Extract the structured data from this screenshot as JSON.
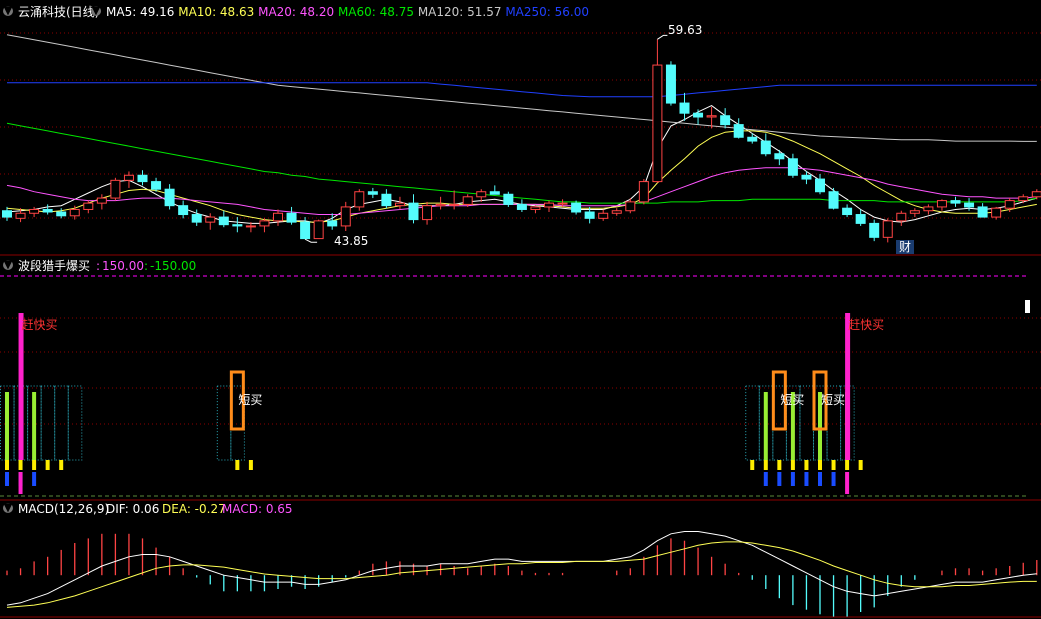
{
  "colors": {
    "bg": "#000000",
    "up": "#ff4444",
    "down": "#54fcfc",
    "grid": "#8b0000",
    "ma5": "#ffffff",
    "ma10": "#ffff55",
    "ma20": "#ff55ff",
    "ma60": "#00e600",
    "ma120": "#c8c8c8",
    "ma250": "#2040ff",
    "dif": "#ffffff",
    "dea": "#ffff55",
    "macd_label": "#ff55ff",
    "level_line": "#ff00ff",
    "zero_line": "#5a8a3a"
  },
  "main_panel": {
    "stock": "云涌科技(日线)",
    "indicators": [
      {
        "label": "MA5: 49.16",
        "color": "#ffffff"
      },
      {
        "label": "MA10: 48.63",
        "color": "#ffff55"
      },
      {
        "label": "MA20: 48.20",
        "color": "#ff55ff"
      },
      {
        "label": "MA60: 48.75",
        "color": "#00e600"
      },
      {
        "label": "MA120: 51.57",
        "color": "#c8c8c8"
      },
      {
        "label": "MA250: 56.00",
        "color": "#2040ff"
      }
    ],
    "high_label": "59.63",
    "low_label": "43.85",
    "fin_badge": "财"
  },
  "signal_panel": {
    "title": "波段猎手爆买",
    "val1": "150.00",
    "val2": "-150.00",
    "labels": [
      "赶快买",
      "短买",
      "短买",
      "短买",
      "赶快买"
    ]
  },
  "macd_panel": {
    "title": "MACD(12,26,9)",
    "dif": "DIF: 0.06",
    "dea": "DEA: -0.27",
    "macd": "MACD: 0.65"
  },
  "chart_data": {
    "type": "candlestick",
    "ylim": [
      43,
      61
    ],
    "candles": [
      [
        46.1,
        46.4,
        45.3,
        45.6
      ],
      [
        45.5,
        46.3,
        45.2,
        45.9
      ],
      [
        45.9,
        46.4,
        45.6,
        46.2
      ],
      [
        46.2,
        46.6,
        45.8,
        46.0
      ],
      [
        46.0,
        46.3,
        45.5,
        45.7
      ],
      [
        45.7,
        46.5,
        45.4,
        46.2
      ],
      [
        46.2,
        46.9,
        45.9,
        46.7
      ],
      [
        46.7,
        47.4,
        46.2,
        47.1
      ],
      [
        47.1,
        48.7,
        46.9,
        48.5
      ],
      [
        48.5,
        49.2,
        47.9,
        48.9
      ],
      [
        48.9,
        49.3,
        48.1,
        48.4
      ],
      [
        48.4,
        48.7,
        47.6,
        47.8
      ],
      [
        47.8,
        48.2,
        46.2,
        46.5
      ],
      [
        46.5,
        46.9,
        45.5,
        45.8
      ],
      [
        45.8,
        46.2,
        44.9,
        45.2
      ],
      [
        45.2,
        45.9,
        44.6,
        45.6
      ],
      [
        45.6,
        46.1,
        44.8,
        45.0
      ],
      [
        45.0,
        45.6,
        44.4,
        44.9
      ],
      [
        44.9,
        45.2,
        44.4,
        44.9
      ],
      [
        44.9,
        45.5,
        44.4,
        45.3
      ],
      [
        45.3,
        46.2,
        44.9,
        45.9
      ],
      [
        45.9,
        46.4,
        45.0,
        45.2
      ],
      [
        45.2,
        45.6,
        43.85,
        43.9
      ],
      [
        43.9,
        45.4,
        43.9,
        45.3
      ],
      [
        45.3,
        45.9,
        44.6,
        44.9
      ],
      [
        44.9,
        46.8,
        44.5,
        46.4
      ],
      [
        46.4,
        47.8,
        46.1,
        47.6
      ],
      [
        47.6,
        47.9,
        47.1,
        47.4
      ],
      [
        47.4,
        47.8,
        46.3,
        46.5
      ],
      [
        46.5,
        47.2,
        46.2,
        46.7
      ],
      [
        46.7,
        47.4,
        45.1,
        45.4
      ],
      [
        45.4,
        46.8,
        45.0,
        46.5
      ],
      [
        46.5,
        47.2,
        46.2,
        46.6
      ],
      [
        46.6,
        47.7,
        46.2,
        46.6
      ],
      [
        46.6,
        47.4,
        46.4,
        47.2
      ],
      [
        47.2,
        47.8,
        46.8,
        47.6
      ],
      [
        47.6,
        48.1,
        47.4,
        47.4
      ],
      [
        47.4,
        47.6,
        46.4,
        46.6
      ],
      [
        46.6,
        47.0,
        46.0,
        46.2
      ],
      [
        46.2,
        46.5,
        45.9,
        46.4
      ],
      [
        46.4,
        46.9,
        46.0,
        46.7
      ],
      [
        46.7,
        47.0,
        46.4,
        46.7
      ],
      [
        46.7,
        46.9,
        45.8,
        46.0
      ],
      [
        46.0,
        46.4,
        45.1,
        45.5
      ],
      [
        45.5,
        46.2,
        45.3,
        45.9
      ],
      [
        45.9,
        46.3,
        45.7,
        46.1
      ],
      [
        46.1,
        47.1,
        45.9,
        46.8
      ],
      [
        46.8,
        48.6,
        46.6,
        48.4
      ],
      [
        48.4,
        59.63,
        48.3,
        57.6
      ],
      [
        57.6,
        57.9,
        54.4,
        54.6
      ],
      [
        54.6,
        55.4,
        53.2,
        53.8
      ],
      [
        53.8,
        54.1,
        52.9,
        53.5
      ],
      [
        53.5,
        54.3,
        52.6,
        53.6
      ],
      [
        53.6,
        54.2,
        52.6,
        52.9
      ],
      [
        52.9,
        53.4,
        51.8,
        51.9
      ],
      [
        51.9,
        52.2,
        51.4,
        51.6
      ],
      [
        51.6,
        52.2,
        50.4,
        50.6
      ],
      [
        50.6,
        50.9,
        49.7,
        50.2
      ],
      [
        50.2,
        50.6,
        48.7,
        48.9
      ],
      [
        48.9,
        49.2,
        48.2,
        48.6
      ],
      [
        48.6,
        49.0,
        47.4,
        47.6
      ],
      [
        47.6,
        47.9,
        46.2,
        46.3
      ],
      [
        46.3,
        46.6,
        45.6,
        45.8
      ],
      [
        45.8,
        46.2,
        44.9,
        45.1
      ],
      [
        45.1,
        45.4,
        43.7,
        44.0
      ],
      [
        44.0,
        45.5,
        43.6,
        45.3
      ],
      [
        45.3,
        46.1,
        44.9,
        45.9
      ],
      [
        45.9,
        46.3,
        45.6,
        46.1
      ],
      [
        46.1,
        46.6,
        45.8,
        46.4
      ],
      [
        46.4,
        47.0,
        46.1,
        46.9
      ],
      [
        46.9,
        47.2,
        46.4,
        46.7
      ],
      [
        46.7,
        47.1,
        46.1,
        46.4
      ],
      [
        46.4,
        46.7,
        45.9,
        45.6
      ],
      [
        45.6,
        46.4,
        45.4,
        46.3
      ],
      [
        46.3,
        47.1,
        46.0,
        46.9
      ],
      [
        46.9,
        47.4,
        46.7,
        47.2
      ],
      [
        47.2,
        47.8,
        47.0,
        47.6
      ]
    ],
    "ma_series": [
      {
        "name": "MA5",
        "color": "#ffffff",
        "values": [
          46.0,
          46.1,
          46.2,
          46.4,
          46.5,
          47.0,
          47.5,
          48.0,
          48.4,
          48.5,
          48.0,
          47.4,
          46.8,
          46.3,
          45.9,
          45.6,
          45.3,
          45.2,
          45.1,
          45.1,
          45.2,
          45.3,
          45.3,
          45.1,
          45.5,
          46.2,
          46.6,
          46.8,
          47.0,
          46.8,
          46.5,
          46.5,
          46.5,
          46.6,
          46.8,
          46.9,
          47.0,
          46.8,
          46.6,
          46.5,
          46.4,
          46.3,
          46.2,
          46.2,
          46.2,
          46.5,
          47.0,
          48.0,
          51.0,
          52.8,
          53.3,
          53.9,
          54.4,
          53.6,
          52.9,
          52.2,
          51.5,
          50.8,
          50.0,
          49.2,
          48.5,
          47.7,
          47.0,
          46.2,
          45.6,
          45.3,
          45.2,
          45.4,
          45.7,
          46.0,
          46.2,
          46.3,
          46.2,
          46.3,
          46.5,
          46.8,
          47.1
        ]
      },
      {
        "name": "MA10",
        "color": "#ffff55",
        "values": [
          46.3,
          46.2,
          46.1,
          46.0,
          46.1,
          46.3,
          46.7,
          47.1,
          47.4,
          47.7,
          47.8,
          47.7,
          47.4,
          47.1,
          46.8,
          46.5,
          46.1,
          45.8,
          45.6,
          45.4,
          45.3,
          45.3,
          45.2,
          45.2,
          45.3,
          45.6,
          45.9,
          46.1,
          46.3,
          46.5,
          46.6,
          46.7,
          46.7,
          46.6,
          46.6,
          46.6,
          46.6,
          46.6,
          46.6,
          46.6,
          46.5,
          46.4,
          46.3,
          46.3,
          46.3,
          46.4,
          46.6,
          47.1,
          48.3,
          49.3,
          50.2,
          51.2,
          51.9,
          52.3,
          52.4,
          52.4,
          52.3,
          52.0,
          51.6,
          51.1,
          50.6,
          50.0,
          49.4,
          48.8,
          48.1,
          47.5,
          46.9,
          46.5,
          46.2,
          46.0,
          45.9,
          45.9,
          45.9,
          46.0,
          46.2,
          46.4,
          46.6
        ]
      },
      {
        "name": "MA20",
        "color": "#ff55ff",
        "values": [
          48.1,
          47.9,
          47.6,
          47.4,
          47.2,
          47.0,
          46.9,
          46.9,
          46.9,
          47.0,
          47.1,
          47.1,
          47.1,
          47.0,
          46.9,
          46.8,
          46.7,
          46.6,
          46.4,
          46.2,
          46.1,
          46.0,
          45.9,
          45.8,
          45.8,
          45.8,
          45.9,
          46.0,
          46.1,
          46.2,
          46.3,
          46.4,
          46.5,
          46.5,
          46.5,
          46.6,
          46.6,
          46.6,
          46.6,
          46.6,
          46.6,
          46.5,
          46.5,
          46.5,
          46.5,
          46.5,
          46.6,
          46.8,
          47.2,
          47.6,
          48.0,
          48.4,
          48.8,
          49.1,
          49.3,
          49.4,
          49.5,
          49.5,
          49.5,
          49.4,
          49.3,
          49.1,
          48.9,
          48.7,
          48.5,
          48.2,
          48.0,
          47.8,
          47.6,
          47.4,
          47.3,
          47.2,
          47.2,
          47.1,
          47.1,
          47.1,
          47.2
        ]
      },
      {
        "name": "MA60",
        "color": "#00e600",
        "values": [
          53.0,
          52.8,
          52.6,
          52.4,
          52.2,
          52.0,
          51.8,
          51.6,
          51.4,
          51.2,
          51.0,
          50.8,
          50.6,
          50.4,
          50.2,
          50.0,
          49.8,
          49.6,
          49.4,
          49.2,
          49.1,
          48.9,
          48.8,
          48.6,
          48.5,
          48.4,
          48.3,
          48.2,
          48.1,
          48.0,
          47.9,
          47.8,
          47.7,
          47.6,
          47.5,
          47.4,
          47.3,
          47.2,
          47.1,
          47.0,
          46.9,
          46.8,
          46.8,
          46.7,
          46.7,
          46.7,
          46.7,
          46.7,
          46.7,
          46.8,
          46.8,
          46.8,
          46.9,
          46.9,
          46.9,
          47.0,
          47.0,
          47.0,
          47.0,
          47.0,
          47.0,
          46.9,
          46.9,
          46.9,
          46.9,
          46.8,
          46.8,
          46.8,
          46.8,
          46.8,
          46.8,
          46.8,
          46.8,
          46.8,
          46.8,
          46.9,
          47.1
        ]
      },
      {
        "name": "MA120",
        "color": "#c8c8c8",
        "values": [
          60.0,
          59.8,
          59.6,
          59.4,
          59.2,
          59.0,
          58.8,
          58.6,
          58.4,
          58.2,
          58.0,
          57.8,
          57.6,
          57.4,
          57.2,
          57.0,
          56.8,
          56.6,
          56.4,
          56.2,
          56.0,
          55.9,
          55.8,
          55.7,
          55.6,
          55.5,
          55.4,
          55.3,
          55.2,
          55.1,
          55.0,
          54.9,
          54.8,
          54.7,
          54.6,
          54.5,
          54.4,
          54.3,
          54.2,
          54.1,
          54.0,
          53.9,
          53.8,
          53.7,
          53.6,
          53.5,
          53.4,
          53.3,
          53.2,
          53.1,
          53.0,
          52.9,
          52.8,
          52.7,
          52.6,
          52.5,
          52.4,
          52.3,
          52.2,
          52.1,
          52.0,
          51.95,
          51.9,
          51.85,
          51.8,
          51.75,
          51.7,
          51.7,
          51.7,
          51.65,
          51.6,
          51.6,
          51.6,
          51.6,
          51.6,
          51.57,
          51.57
        ]
      },
      {
        "name": "MA250",
        "color": "#2040ff",
        "values": [
          56.2,
          56.2,
          56.2,
          56.2,
          56.2,
          56.2,
          56.2,
          56.2,
          56.2,
          56.2,
          56.2,
          56.2,
          56.2,
          56.2,
          56.2,
          56.2,
          56.2,
          56.2,
          56.2,
          56.2,
          56.2,
          56.2,
          56.2,
          56.2,
          56.2,
          56.2,
          56.2,
          56.2,
          56.2,
          56.2,
          56.2,
          56.2,
          56.1,
          56.0,
          55.9,
          55.8,
          55.7,
          55.6,
          55.5,
          55.4,
          55.3,
          55.2,
          55.15,
          55.1,
          55.1,
          55.1,
          55.1,
          55.1,
          55.1,
          55.2,
          55.3,
          55.4,
          55.5,
          55.6,
          55.7,
          55.8,
          55.9,
          56.0,
          56.0,
          56.0,
          56.0,
          56.0,
          56.0,
          56.0,
          56.0,
          56.0,
          56.0,
          56.0,
          56.0,
          56.0,
          56.0,
          56.0,
          56.0,
          56.0,
          56.0,
          56.0,
          56.0
        ]
      }
    ],
    "signals": {
      "green": [
        0,
        2,
        56,
        58,
        60,
        62
      ],
      "magenta": [
        1,
        62
      ],
      "orange_box": [
        17,
        57,
        60
      ],
      "dotted_boxes": [
        [
          0,
          5
        ],
        [
          16,
          17
        ],
        [
          55,
          62
        ]
      ],
      "yellow_ticks": [
        0,
        1,
        2,
        3,
        4,
        17,
        18,
        55,
        56,
        57,
        58,
        59,
        60,
        61,
        62,
        63
      ],
      "blue_ticks": [
        0,
        1,
        2,
        56,
        57,
        58,
        59,
        60,
        61
      ],
      "buy_label_idx": [
        1,
        17,
        57,
        60,
        62
      ]
    },
    "macd": {
      "ylim": [
        -1.6,
        2.4
      ],
      "dif": [
        -1.3,
        -1.2,
        -1.0,
        -0.8,
        -0.5,
        -0.2,
        0.1,
        0.4,
        0.6,
        0.8,
        0.9,
        0.9,
        0.8,
        0.6,
        0.4,
        0.2,
        0.0,
        -0.1,
        -0.2,
        -0.3,
        -0.3,
        -0.3,
        -0.4,
        -0.4,
        -0.3,
        -0.2,
        0.0,
        0.2,
        0.3,
        0.4,
        0.4,
        0.4,
        0.5,
        0.5,
        0.5,
        0.6,
        0.7,
        0.7,
        0.6,
        0.6,
        0.6,
        0.6,
        0.6,
        0.6,
        0.6,
        0.7,
        0.8,
        1.1,
        1.5,
        1.8,
        1.9,
        1.9,
        1.8,
        1.7,
        1.5,
        1.3,
        1.0,
        0.7,
        0.4,
        0.1,
        -0.2,
        -0.5,
        -0.7,
        -0.8,
        -0.9,
        -0.8,
        -0.7,
        -0.6,
        -0.5,
        -0.4,
        -0.3,
        -0.3,
        -0.3,
        -0.2,
        -0.1,
        0.0,
        0.06
      ],
      "dea": [
        -1.4,
        -1.35,
        -1.3,
        -1.2,
        -1.05,
        -0.9,
        -0.7,
        -0.5,
        -0.3,
        -0.1,
        0.1,
        0.3,
        0.4,
        0.45,
        0.45,
        0.4,
        0.35,
        0.25,
        0.15,
        0.05,
        0.0,
        -0.05,
        -0.1,
        -0.15,
        -0.15,
        -0.15,
        -0.1,
        -0.05,
        0.0,
        0.1,
        0.15,
        0.2,
        0.25,
        0.3,
        0.35,
        0.4,
        0.45,
        0.5,
        0.5,
        0.55,
        0.55,
        0.55,
        0.6,
        0.6,
        0.6,
        0.6,
        0.65,
        0.7,
        0.85,
        1.0,
        1.15,
        1.3,
        1.4,
        1.45,
        1.45,
        1.4,
        1.3,
        1.2,
        1.05,
        0.85,
        0.65,
        0.4,
        0.2,
        0.0,
        -0.2,
        -0.35,
        -0.45,
        -0.5,
        -0.5,
        -0.5,
        -0.45,
        -0.45,
        -0.4,
        -0.35,
        -0.3,
        -0.27,
        -0.27
      ],
      "hist_visible_from": 0
    }
  }
}
